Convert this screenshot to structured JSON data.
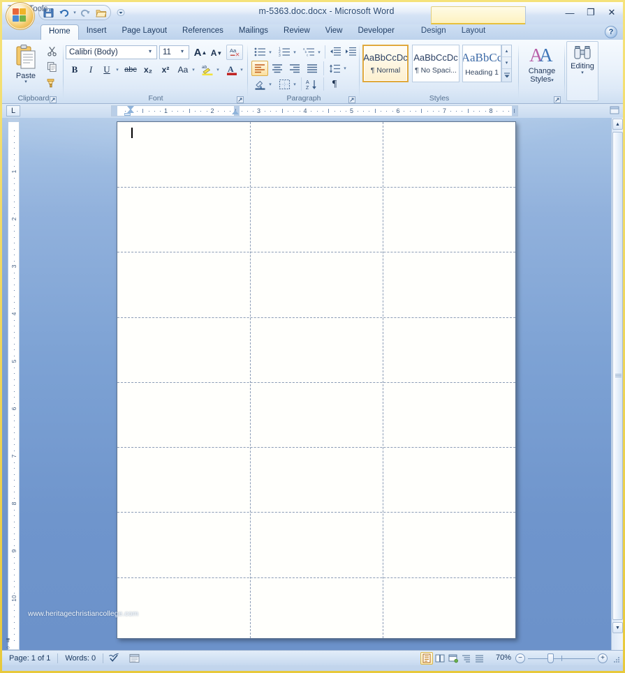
{
  "window": {
    "title": "m-5363.doc.docx  -  Microsoft Word",
    "minimize_label": "—",
    "restore_label": "❐",
    "close_label": "✕",
    "help_label": "?"
  },
  "quick_access": {
    "items": [
      {
        "name": "save-icon",
        "tooltip": "Save"
      },
      {
        "name": "undo-icon",
        "tooltip": "Undo"
      },
      {
        "name": "redo-icon",
        "tooltip": "Redo"
      },
      {
        "name": "open-icon",
        "tooltip": "Open"
      }
    ],
    "customize_glyph": "▾"
  },
  "contextual": {
    "group_title": "Table Tools"
  },
  "tabs": [
    {
      "label": "Home",
      "active": true
    },
    {
      "label": "Insert",
      "active": false
    },
    {
      "label": "Page Layout",
      "active": false
    },
    {
      "label": "References",
      "active": false
    },
    {
      "label": "Mailings",
      "active": false
    },
    {
      "label": "Review",
      "active": false
    },
    {
      "label": "View",
      "active": false
    },
    {
      "label": "Developer",
      "active": false
    },
    {
      "label": "Design",
      "active": false,
      "contextual": true
    },
    {
      "label": "Layout",
      "active": false,
      "contextual": true
    }
  ],
  "ribbon": {
    "clipboard": {
      "group_label": "Clipboard",
      "paste_label": "Paste",
      "paste_dropdown_glyph": "▾",
      "cut_label": "Cut",
      "copy_label": "Copy",
      "format_painter_label": "Format Painter",
      "dialog_launcher_label": "Clipboard dialog"
    },
    "font": {
      "group_label": "Font",
      "font_name": "Calibri (Body)",
      "font_size": "11",
      "combo_arrow": "▾",
      "grow_font_label": "A",
      "shrink_font_label": "A",
      "clear_formatting_label": "Aa",
      "bold_label": "B",
      "italic_label": "I",
      "underline_label": "U",
      "strikethrough_label": "abc",
      "subscript_label": "x₂",
      "superscript_label": "x²",
      "change_case_label": "Aa",
      "highlight_label": "ab",
      "font_color_label": "A",
      "dialog_launcher_label": "Font dialog"
    },
    "paragraph": {
      "group_label": "Paragraph",
      "bullets_label": "Bullets",
      "numbering_label": "Numbering",
      "multilevel_label": "Multilevel List",
      "decrease_indent_label": "Decrease Indent",
      "increase_indent_label": "Increase Indent",
      "align_left_label": "Align Left",
      "align_center_label": "Center",
      "align_right_label": "Align Right",
      "justify_label": "Justify",
      "line_spacing_label": "Line Spacing",
      "shading_label": "Shading",
      "borders_label": "Borders",
      "sort_label": "Sort",
      "show_marks_label": "¶",
      "dialog_launcher_label": "Paragraph dialog"
    },
    "styles": {
      "group_label": "Styles",
      "items": [
        {
          "sample": "AaBbCcDc",
          "name": "¶ Normal",
          "selected": true
        },
        {
          "sample": "AaBbCcDc",
          "name": "¶ No Spaci...",
          "selected": false
        },
        {
          "sample": "AaBbCс",
          "name": "Heading 1",
          "selected": false
        }
      ],
      "scroll_up_glyph": "▴",
      "scroll_down_glyph": "▾",
      "more_glyph": "▾",
      "dialog_launcher_label": "Styles dialog"
    },
    "change_styles": {
      "label_line1": "Change",
      "label_line2": "Styles",
      "dropdown_glyph": "▾"
    },
    "editing": {
      "label": "Editing",
      "dropdown_glyph": "▾",
      "icon_name": "binoculars-icon"
    }
  },
  "ruler": {
    "tab_stop_glyph": "L",
    "horizontal_numbers": [
      "1",
      "2",
      "3",
      "4",
      "5",
      "6",
      "7",
      "8"
    ],
    "vertical_numbers": [
      "1",
      "2",
      "3",
      "4",
      "5",
      "6",
      "7",
      "8",
      "9",
      "10"
    ]
  },
  "document": {
    "watermark": "www.heritagechristiancollege.com",
    "table": {
      "columns": 3,
      "rows": 8,
      "gridline_style": "dashed",
      "col_x_percent": [
        33.3,
        66.6
      ],
      "row_y_percent": [
        12.6,
        25.2,
        37.8,
        50.4,
        63.0,
        75.6,
        88.2
      ]
    }
  },
  "status_bar": {
    "page_label": "Page: 1 of 1",
    "words_label": "Words: 0",
    "proofing_icon": "spelling-check-icon",
    "language_icon": "language-icon",
    "zoom_level": "70%",
    "zoom_out_glyph": "−",
    "zoom_in_glyph": "+",
    "view_buttons": [
      {
        "name": "print-layout-view",
        "selected": true
      },
      {
        "name": "full-screen-reading-view",
        "selected": false
      },
      {
        "name": "web-layout-view",
        "selected": false
      },
      {
        "name": "outline-view",
        "selected": false
      },
      {
        "name": "draft-view",
        "selected": false
      }
    ]
  },
  "scrollbar": {
    "up_glyph": "▲",
    "down_glyph": "▼",
    "prev_page_glyph": "⇈",
    "select_object_glyph": "○",
    "next_page_glyph": "⇊"
  },
  "colors": {
    "window_border": "#e8c93c",
    "accent_gold": "#e0a93c",
    "workspace_blue": "#7da2d4",
    "page_white": "#fffffc"
  }
}
